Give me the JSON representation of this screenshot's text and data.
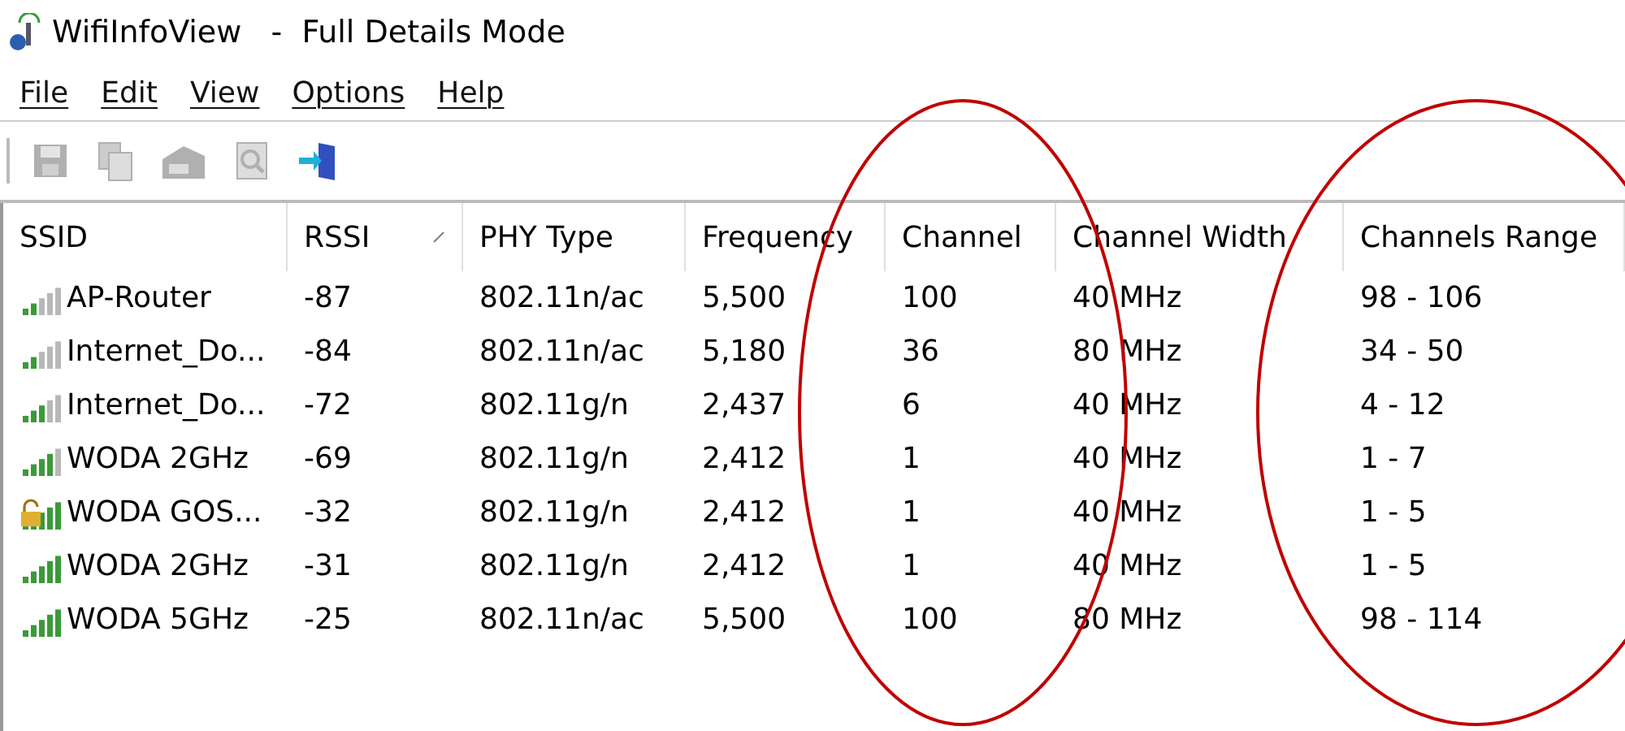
{
  "window": {
    "title": "WifiInfoView   -  Full Details Mode"
  },
  "menu": [
    "File",
    "Edit",
    "View",
    "Options",
    "Help"
  ],
  "toolbar": [
    {
      "kind": "save",
      "disabled": true
    },
    {
      "kind": "copy",
      "disabled": true
    },
    {
      "kind": "properties",
      "disabled": true
    },
    {
      "kind": "find",
      "disabled": true
    },
    {
      "kind": "exit",
      "disabled": false
    }
  ],
  "table": {
    "columns": [
      {
        "label": "SSID",
        "sorted": false,
        "highlighted": false
      },
      {
        "label": "RSSI",
        "sorted": true,
        "highlighted": false
      },
      {
        "label": "PHY Type",
        "sorted": false,
        "highlighted": false
      },
      {
        "label": "Frequency",
        "sorted": false,
        "highlighted": false
      },
      {
        "label": "Channel",
        "sorted": false,
        "highlighted": true
      },
      {
        "label": "Channel Width",
        "sorted": false,
        "highlighted": false
      },
      {
        "label": "Channels Range",
        "sorted": false,
        "highlighted": true
      }
    ],
    "rows": [
      {
        "kind": "weak",
        "locked": false,
        "cells": [
          "AP-Router",
          "-87",
          "802.11n/ac",
          "5,500",
          "100",
          "40 MHz",
          "98 - 106"
        ]
      },
      {
        "kind": "weak",
        "locked": false,
        "cells": [
          "Internet_Do...",
          "-84",
          "802.11n/ac",
          "5,180",
          "36",
          "80 MHz",
          "34 - 50"
        ]
      },
      {
        "kind": "medium",
        "locked": false,
        "cells": [
          "Internet_Do...",
          "-72",
          "802.11g/n",
          "2,437",
          "6",
          "40 MHz",
          "4 - 12"
        ]
      },
      {
        "kind": "good",
        "locked": false,
        "cells": [
          "WODA 2GHz",
          "-69",
          "802.11g/n",
          "2,412",
          "1",
          "40 MHz",
          "1 - 7"
        ]
      },
      {
        "kind": "strong",
        "locked": true,
        "cells": [
          "WODA GOS...",
          "-32",
          "802.11g/n",
          "2,412",
          "1",
          "40 MHz",
          "1 - 5"
        ]
      },
      {
        "kind": "strong",
        "locked": false,
        "cells": [
          "WODA 2GHz",
          "-31",
          "802.11g/n",
          "2,412",
          "1",
          "40 MHz",
          "1 - 5"
        ]
      },
      {
        "kind": "strong",
        "locked": false,
        "cells": [
          "WODA 5GHz",
          "-25",
          "802.11n/ac",
          "5,500",
          "100",
          "80 MHz",
          "98 - 114"
        ]
      }
    ]
  }
}
